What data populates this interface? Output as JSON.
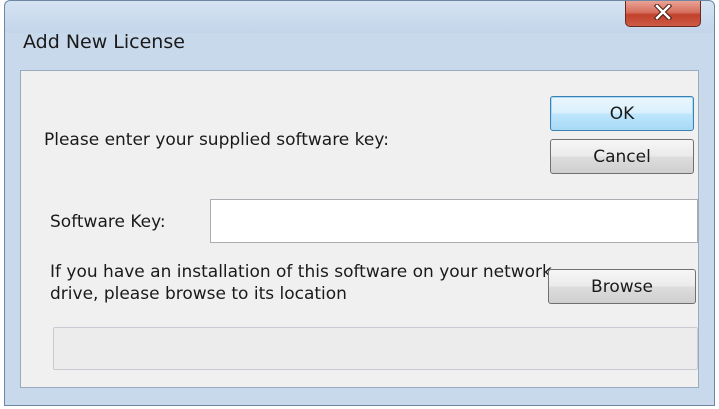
{
  "window": {
    "title": "Add New License",
    "close_icon": "close-x-icon"
  },
  "dialog": {
    "prompt_text": "Please enter your supplied software key:",
    "ok_label": "OK",
    "cancel_label": "Cancel",
    "software_key_label": "Software Key:",
    "software_key_value": "",
    "browse_text": "If you have an installation of this software on your network drive, please browse to its location",
    "browse_label": "Browse",
    "location_value": ""
  },
  "colors": {
    "close_button": "#c1412c",
    "frame": "#c9d9ec",
    "client_bg": "#f0f0f0",
    "default_button_border": "#3c7fb1"
  }
}
